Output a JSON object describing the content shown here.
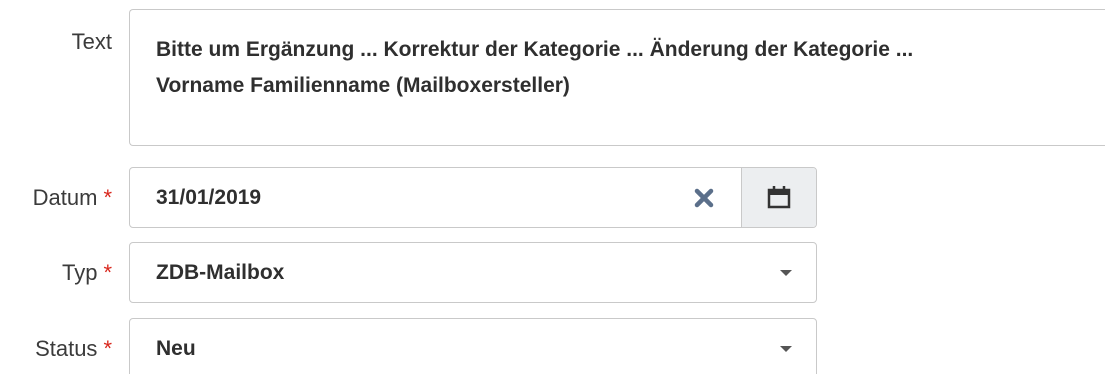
{
  "fields": {
    "text": {
      "label": "Text",
      "line1": "Bitte um Ergänzung ... Korrektur der Kategorie ... Änderung der Kategorie ...",
      "line2": "Vorname Familienname (Mailboxersteller)"
    },
    "datum": {
      "label": "Datum",
      "required_mark": "*",
      "value": "31/01/2019"
    },
    "typ": {
      "label": "Typ",
      "required_mark": "*",
      "value": "ZDB-Mailbox"
    },
    "status": {
      "label": "Status",
      "required_mark": "*",
      "value": "Neu"
    }
  },
  "icons": {
    "clear": "close-icon",
    "calendar": "calendar-icon",
    "dropdown": "chevron-down-icon"
  },
  "colors": {
    "required": "#d9261c",
    "clear_icon": "#5b6f8a",
    "calendar_button_bg": "#eceef0"
  }
}
